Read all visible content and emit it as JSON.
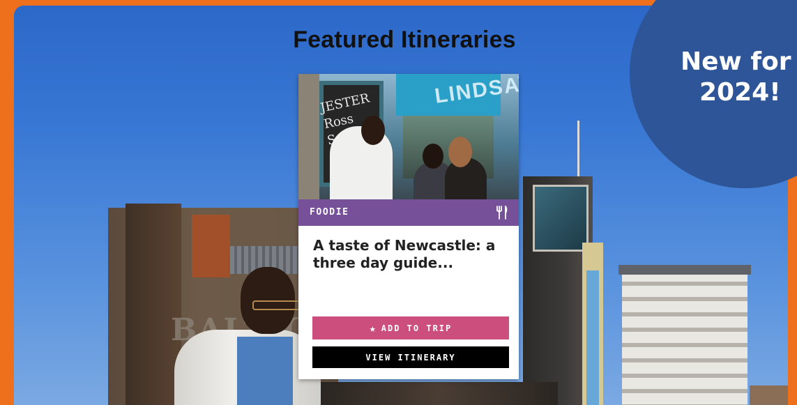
{
  "section": {
    "title": "Featured Itineraries"
  },
  "badge": {
    "line1": "New for",
    "line2": "2024!",
    "color": "#2e5597"
  },
  "background": {
    "frame_color": "#ee6f1c",
    "building_sign": "BALTIC"
  },
  "card": {
    "category": "FOODIE",
    "category_icon": "fork-knife-icon",
    "category_color": "#77509a",
    "title": "A taste of Newcastle: a three day guide...",
    "photo": {
      "shop_sign": "LINDSAY",
      "board_text": "JESTER\nRoss\nSalmon"
    },
    "add_button": {
      "icon": "star-icon",
      "label": "ADD TO TRIP",
      "color": "#cb4e7c"
    },
    "view_button": {
      "label": "VIEW ITINERARY",
      "color": "#000000"
    }
  }
}
